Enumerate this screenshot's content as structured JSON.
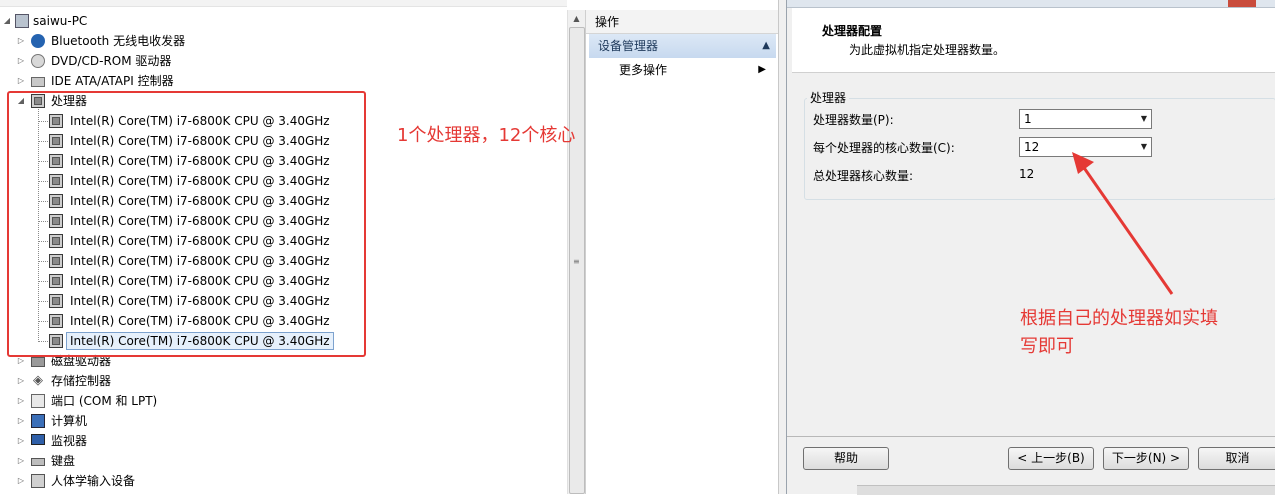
{
  "device_tree": {
    "root": "saiwu-PC",
    "categories_before": [
      {
        "label": "Bluetooth 无线电收发器",
        "icon": "bluetooth-icon"
      },
      {
        "label": "DVD/CD-ROM 驱动器",
        "icon": "dvd-drive-icon"
      },
      {
        "label": "IDE ATA/ATAPI 控制器",
        "icon": "ide-controller-icon"
      }
    ],
    "processor_category": "处理器",
    "processors": [
      "Intel(R) Core(TM) i7-6800K CPU @ 3.40GHz",
      "Intel(R) Core(TM) i7-6800K CPU @ 3.40GHz",
      "Intel(R) Core(TM) i7-6800K CPU @ 3.40GHz",
      "Intel(R) Core(TM) i7-6800K CPU @ 3.40GHz",
      "Intel(R) Core(TM) i7-6800K CPU @ 3.40GHz",
      "Intel(R) Core(TM) i7-6800K CPU @ 3.40GHz",
      "Intel(R) Core(TM) i7-6800K CPU @ 3.40GHz",
      "Intel(R) Core(TM) i7-6800K CPU @ 3.40GHz",
      "Intel(R) Core(TM) i7-6800K CPU @ 3.40GHz",
      "Intel(R) Core(TM) i7-6800K CPU @ 3.40GHz",
      "Intel(R) Core(TM) i7-6800K CPU @ 3.40GHz",
      "Intel(R) Core(TM) i7-6800K CPU @ 3.40GHz"
    ],
    "categories_after": [
      {
        "label": "磁盘驱动器",
        "icon": "disk-drive-icon"
      },
      {
        "label": "存储控制器",
        "icon": "storage-controller-icon"
      },
      {
        "label": "端口 (COM 和 LPT)",
        "icon": "port-icon"
      },
      {
        "label": "计算机",
        "icon": "computer-icon"
      },
      {
        "label": "监视器",
        "icon": "monitor-icon"
      },
      {
        "label": "键盘",
        "icon": "keyboard-icon"
      },
      {
        "label": "人体学输入设备",
        "icon": "hid-icon"
      }
    ]
  },
  "actions": {
    "header": "操作",
    "section": "设备管理器",
    "more": "更多操作"
  },
  "wizard": {
    "heading": "处理器配置",
    "subheading": "为此虚拟机指定处理器数量。",
    "group_label": "处理器",
    "processor_count_label": "处理器数量(P):",
    "processor_count_value": "1",
    "cores_label": "每个处理器的核心数量(C):",
    "cores_value": "12",
    "total_label": "总处理器核心数量:",
    "total_value": "12",
    "buttons": {
      "help": "帮助",
      "back": "< 上一步(B)",
      "next": "下一步(N) >",
      "cancel": "取消"
    }
  },
  "annotations": {
    "cpu_note": "1个处理器，12个核心",
    "fill_note_line1": "根据自己的处理器如实填",
    "fill_note_line2": "写即可"
  },
  "colors": {
    "annotation_red": "#e53935",
    "selection_blue": "#7da2ce",
    "section_header": "#c7d9ef"
  }
}
